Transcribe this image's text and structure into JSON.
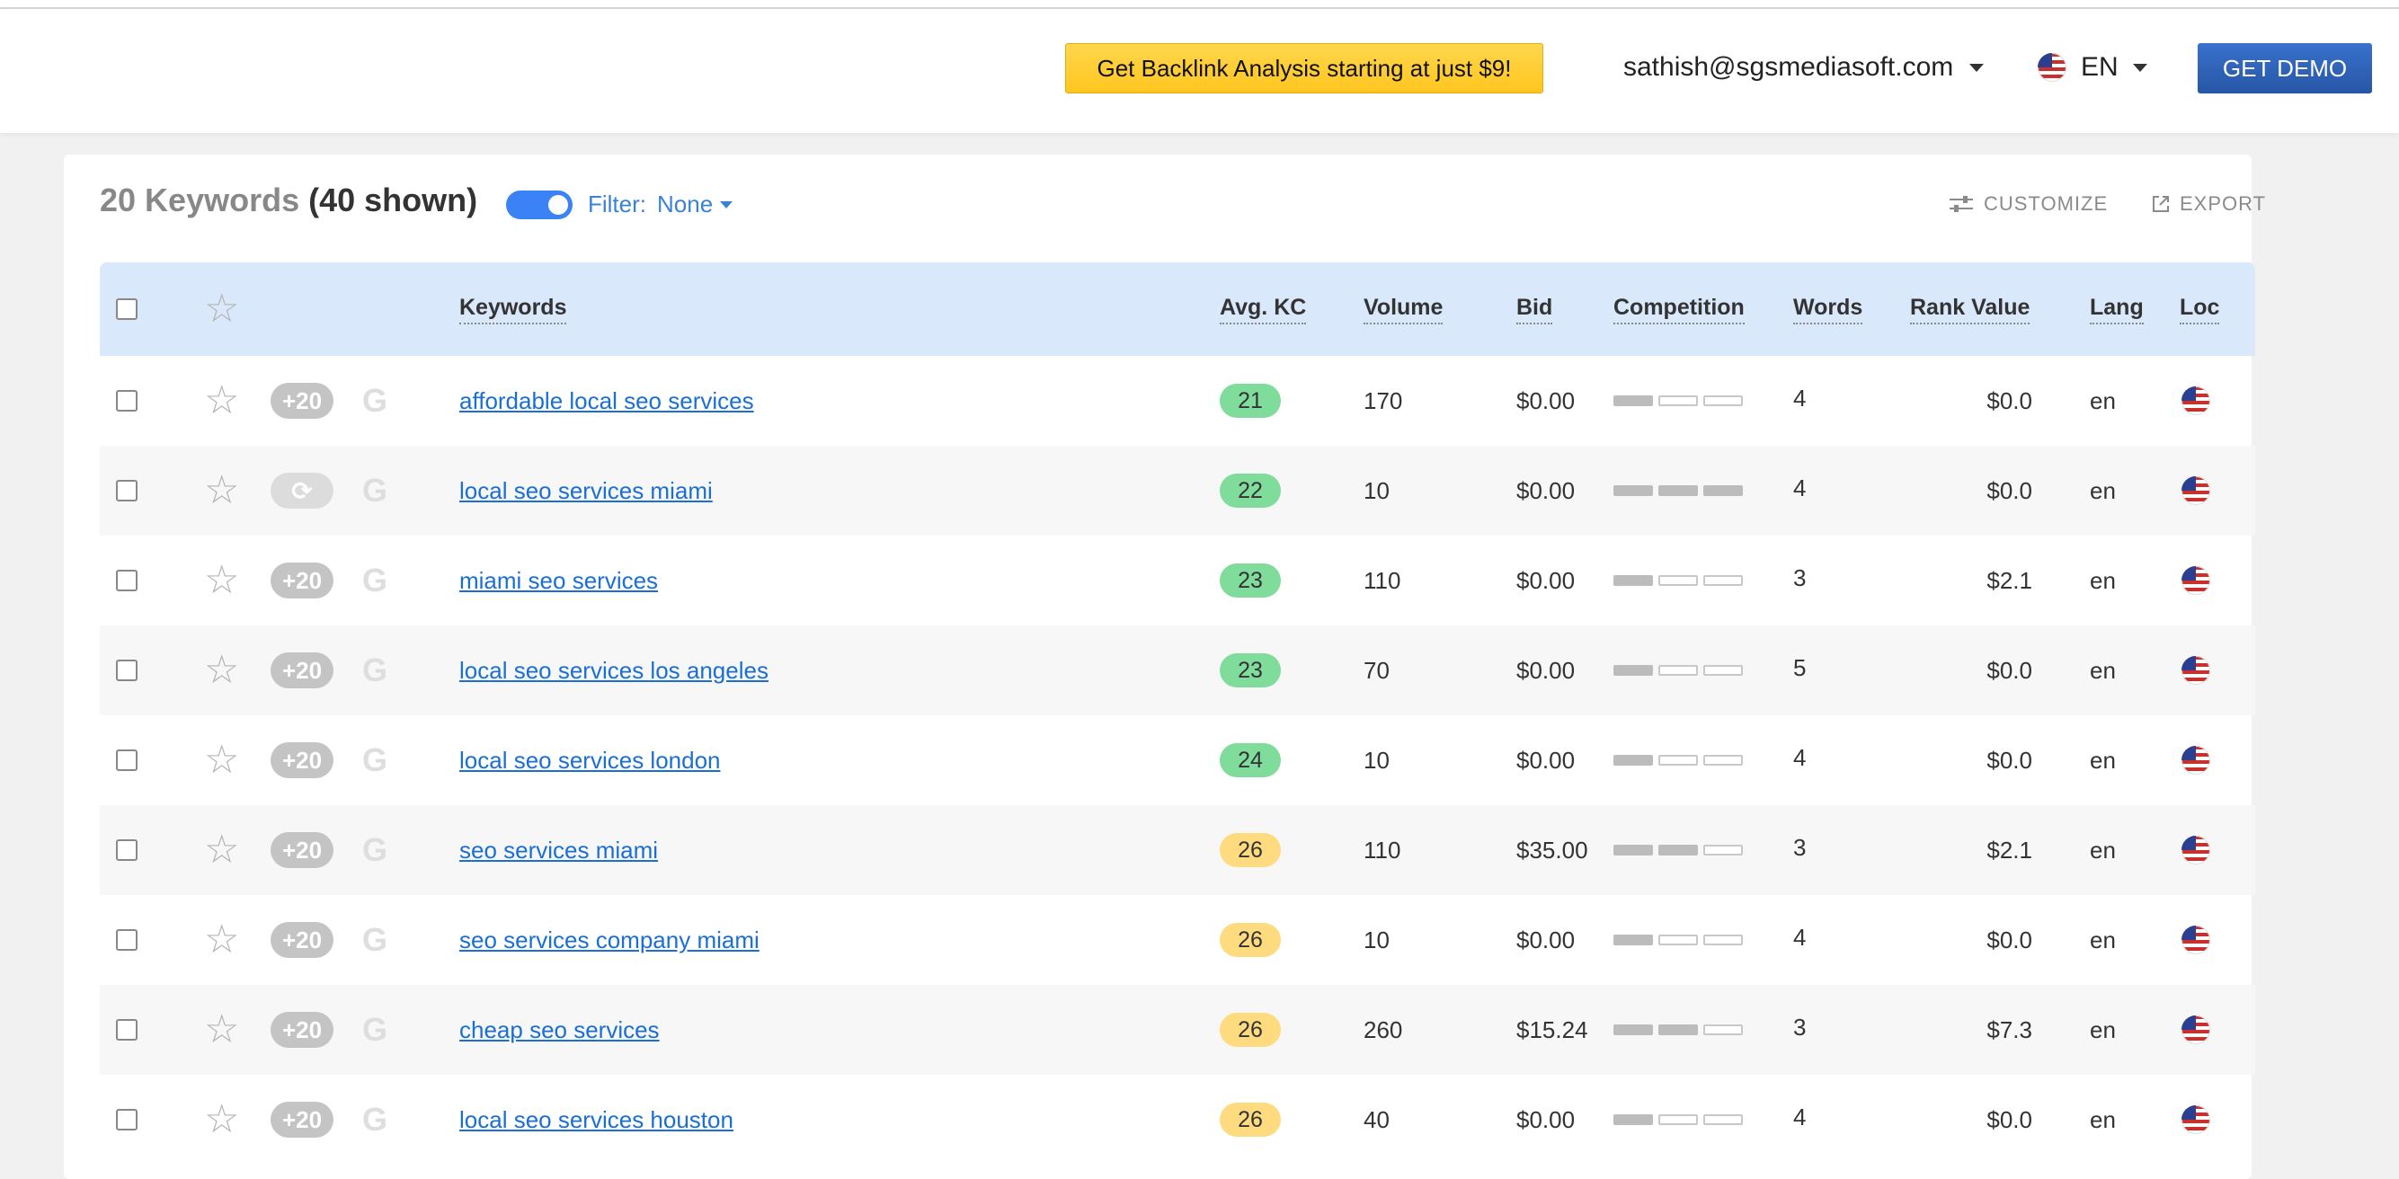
{
  "header": {
    "promo_label": "Get Backlink Analysis starting at just $9!",
    "user_email": "sathish@sgsmediasoft.com",
    "language": "EN",
    "demo_label": "GET DEMO"
  },
  "toolbar": {
    "keyword_count": "20 Keywords",
    "shown_count": "(40 shown)",
    "filter_label": "Filter:",
    "filter_value": "None",
    "customize_label": "CUSTOMIZE",
    "export_label": "EXPORT"
  },
  "columns": {
    "keywords": "Keywords",
    "avg_kc": "Avg. KC",
    "volume": "Volume",
    "bid": "Bid",
    "competition": "Competition",
    "words": "Words",
    "rank_value": "Rank Value",
    "lang": "Lang",
    "loc": "Loc"
  },
  "rows": [
    {
      "badge": "+20",
      "keyword": "affordable local seo services",
      "kc": "21",
      "kc_color": "green",
      "volume": "170",
      "bid": "$0.00",
      "competition": 1,
      "words": "4",
      "rank_value": "$0.0",
      "lang": "en"
    },
    {
      "badge": "⟳",
      "keyword": "local seo services miami",
      "kc": "22",
      "kc_color": "green",
      "volume": "10",
      "bid": "$0.00",
      "competition": 3,
      "words": "4",
      "rank_value": "$0.0",
      "lang": "en"
    },
    {
      "badge": "+20",
      "keyword": "miami seo services",
      "kc": "23",
      "kc_color": "green",
      "volume": "110",
      "bid": "$0.00",
      "competition": 1,
      "words": "3",
      "rank_value": "$2.1",
      "lang": "en"
    },
    {
      "badge": "+20",
      "keyword": "local seo services los angeles",
      "kc": "23",
      "kc_color": "green",
      "volume": "70",
      "bid": "$0.00",
      "competition": 1,
      "words": "5",
      "rank_value": "$0.0",
      "lang": "en"
    },
    {
      "badge": "+20",
      "keyword": "local seo services london",
      "kc": "24",
      "kc_color": "green",
      "volume": "10",
      "bid": "$0.00",
      "competition": 1,
      "words": "4",
      "rank_value": "$0.0",
      "lang": "en"
    },
    {
      "badge": "+20",
      "keyword": "seo services miami",
      "kc": "26",
      "kc_color": "yellow",
      "volume": "110",
      "bid": "$35.00",
      "competition": 2,
      "words": "3",
      "rank_value": "$2.1",
      "lang": "en"
    },
    {
      "badge": "+20",
      "keyword": "seo services company miami",
      "kc": "26",
      "kc_color": "yellow",
      "volume": "10",
      "bid": "$0.00",
      "competition": 1,
      "words": "4",
      "rank_value": "$0.0",
      "lang": "en"
    },
    {
      "badge": "+20",
      "keyword": "cheap seo services",
      "kc": "26",
      "kc_color": "yellow",
      "volume": "260",
      "bid": "$15.24",
      "competition": 2,
      "words": "3",
      "rank_value": "$7.3",
      "lang": "en"
    },
    {
      "badge": "+20",
      "keyword": "local seo services houston",
      "kc": "26",
      "kc_color": "yellow",
      "volume": "40",
      "bid": "$0.00",
      "competition": 1,
      "words": "4",
      "rank_value": "$0.0",
      "lang": "en"
    }
  ]
}
